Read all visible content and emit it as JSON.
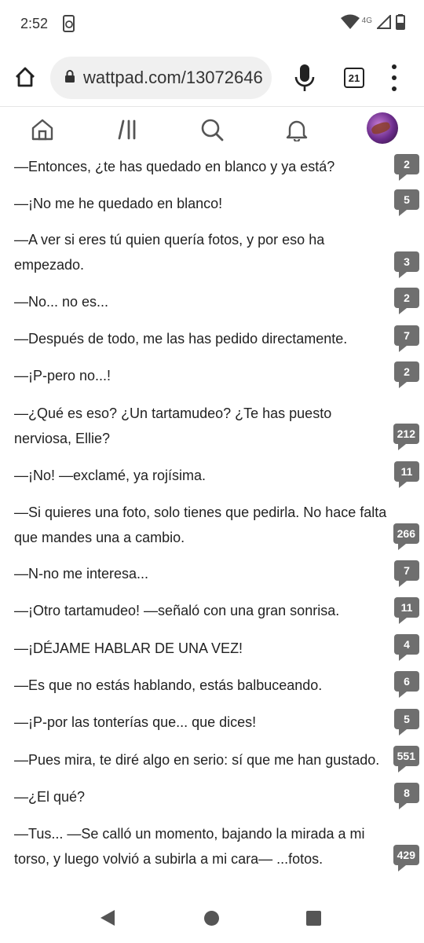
{
  "status_bar": {
    "time": "2:52",
    "network": "4G"
  },
  "browser": {
    "url": "wattpad.com/13072646",
    "tab_count": "21"
  },
  "icons": {
    "home": "home-icon",
    "library": "library-icon",
    "search": "search-icon",
    "notifications": "bell-icon",
    "mic": "mic-icon",
    "menu": "more-vert-icon"
  },
  "story": {
    "paragraphs": [
      {
        "text": "—Entonces, ¿te has quedado en blanco y ya está?",
        "comments": "2"
      },
      {
        "text": "—¡No me he quedado en blanco!",
        "comments": "5"
      },
      {
        "text": "—A ver si eres tú quien quería fotos, y por eso ha empezado.",
        "comments": "3"
      },
      {
        "text": "—No... no es...",
        "comments": "2"
      },
      {
        "text": "—Después de todo, me las has pedido directamente.",
        "comments": "7"
      },
      {
        "text": "—¡P-pero no...!",
        "comments": "2"
      },
      {
        "text": "—¿Qué es eso? ¿Un tartamudeo? ¿Te has puesto nerviosa, Ellie?",
        "comments": "212"
      },
      {
        "text": "—¡No! —exclamé, ya rojísima.",
        "comments": "11"
      },
      {
        "text": "—Si quieres una foto, solo tienes que pedirla. No hace falta que mandes una a cambio.",
        "comments": "266"
      },
      {
        "text": "—N-no me interesa...",
        "comments": "7"
      },
      {
        "text": "—¡Otro tartamudeo! —señaló con una gran sonrisa.",
        "comments": "11"
      },
      {
        "text": "—¡DÉJAME HABLAR DE UNA VEZ!",
        "comments": "4"
      },
      {
        "text": "—Es que no estás hablando, estás balbuceando.",
        "comments": "6"
      },
      {
        "text": "—¡P-por las tonterías que... que dices!",
        "comments": "5"
      },
      {
        "text": "—Pues mira, te diré algo en serio: sí que me han gustado.",
        "comments": "551"
      },
      {
        "text": "—¿El qué?",
        "comments": "8"
      },
      {
        "text": "—Tus... —Se calló un momento, bajando la mirada a mi torso, y luego volvió a subirla a mi cara— ...fotos.",
        "comments": "429"
      }
    ]
  }
}
